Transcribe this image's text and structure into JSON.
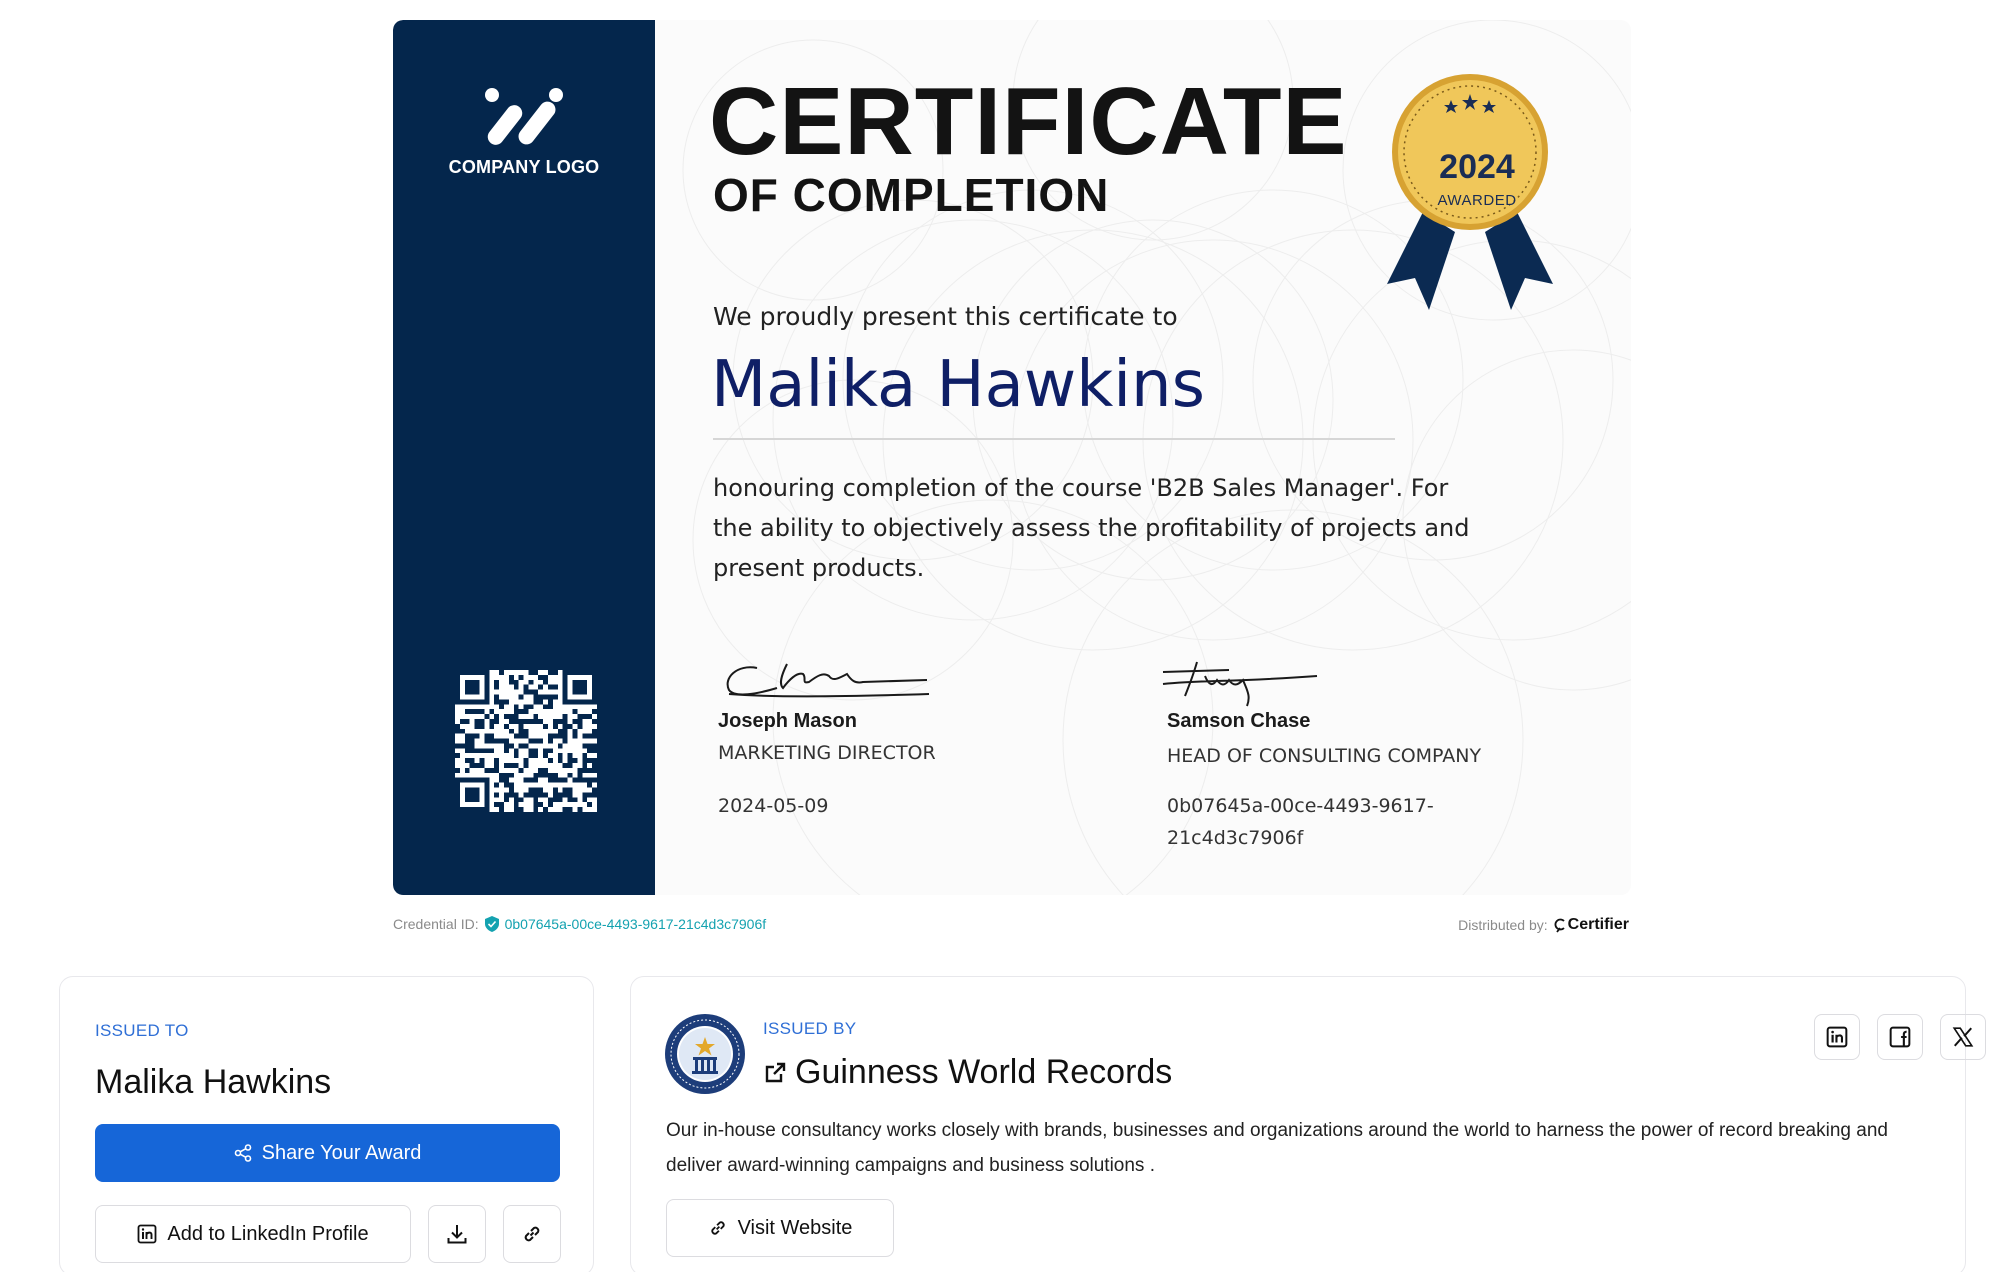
{
  "certificate": {
    "logo_text": "COMPANY LOGO",
    "title": "CERTIFICATE",
    "subtitle": "OF COMPLETION",
    "present_line": "We proudly present this certificate to",
    "recipient": "Malika Hawkins",
    "description": "honouring completion of the course 'B2B Sales Manager'. For the ability to objectively assess the profitability of projects and present products.",
    "seal": {
      "year": "2024",
      "label": "AWARDED"
    },
    "signatories": [
      {
        "name": "Joseph Mason",
        "role": "MARKETING DIRECTOR",
        "meta": "2024-05-09"
      },
      {
        "name": "Samson Chase",
        "role": "HEAD OF CONSULTING COMPANY",
        "meta": "0b07645a-00ce-4493-9617-21c4d3c7906f"
      }
    ],
    "colors": {
      "sidebar": "#04264c",
      "recipient": "#0f1f66",
      "seal_gold": "#e3b33a",
      "ribbon": "#0b2a52"
    }
  },
  "credential": {
    "label": "Credential ID:",
    "id": "0b07645a-00ce-4493-9617-21c4d3c7906f",
    "distributed_label": "Distributed by:",
    "distributor": "Certifier"
  },
  "issued_to": {
    "eyebrow": "ISSUED TO",
    "name": "Malika Hawkins",
    "share_label": "Share Your Award",
    "linkedin_label": "Add to LinkedIn Profile",
    "icons": [
      "share-icon",
      "linkedin-icon",
      "download-icon",
      "link-icon"
    ]
  },
  "issued_by": {
    "eyebrow": "ISSUED BY",
    "name": "Guinness World Records",
    "description": "Our in-house consultancy works closely with brands, businesses and organizations around the world to harness the power of record breaking and deliver award-winning campaigns and business solutions .",
    "visit_label": "Visit Website",
    "social_icons": [
      "linkedin-icon",
      "facebook-icon",
      "x-icon"
    ],
    "logo_text": "GUINNESS WORLD RECORDS"
  },
  "accent": "#1666d8"
}
